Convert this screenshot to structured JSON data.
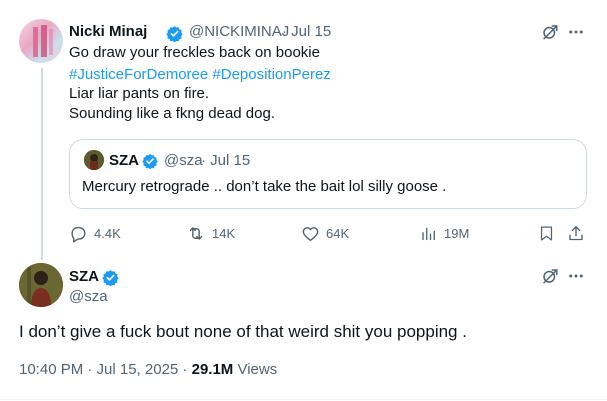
{
  "tweet1": {
    "author_name": "Nicki Minaj",
    "handle": "@NICKIMINAJ",
    "time": "· Jul 15",
    "lines": [
      "Go draw your freckles back on bookie",
      "#JusticeForDemoree #DepositionPerez",
      "Liar liar pants on fire.",
      "Sounding like a fkng dead dog."
    ],
    "hashtags": [
      "#JusticeForDemoree",
      "#DepositionPerez"
    ],
    "quote": {
      "author_name": "SZA",
      "handle": "@sza",
      "time": "· Jul 15",
      "text": "Mercury retrograde .. don’t take the bait lol silly goose ."
    },
    "actions": {
      "replies": "4.4K",
      "reposts": "14K",
      "likes": "64K",
      "views": "19M"
    }
  },
  "tweet2": {
    "author_name": "SZA",
    "handle": "@sza",
    "text": "I don’t give a fuck bout none of that weird shit you popping .",
    "timestamp": "10:40 PM · Jul 15, 2025 ·",
    "views_count": "29.1M",
    "views_label": "Views"
  },
  "icons": {
    "verified": "verified-badge-icon",
    "grok": "grok-icon",
    "more": "more-dots-icon",
    "reply": "reply-icon",
    "repost": "repost-icon",
    "like": "heart-icon",
    "views": "views-bar-icon",
    "bookmark": "bookmark-icon",
    "share": "share-icon"
  },
  "colors": {
    "link": "#1d9bf0",
    "verified": "#1d9bf0",
    "muted": "#536471",
    "border": "#cfd9de"
  }
}
